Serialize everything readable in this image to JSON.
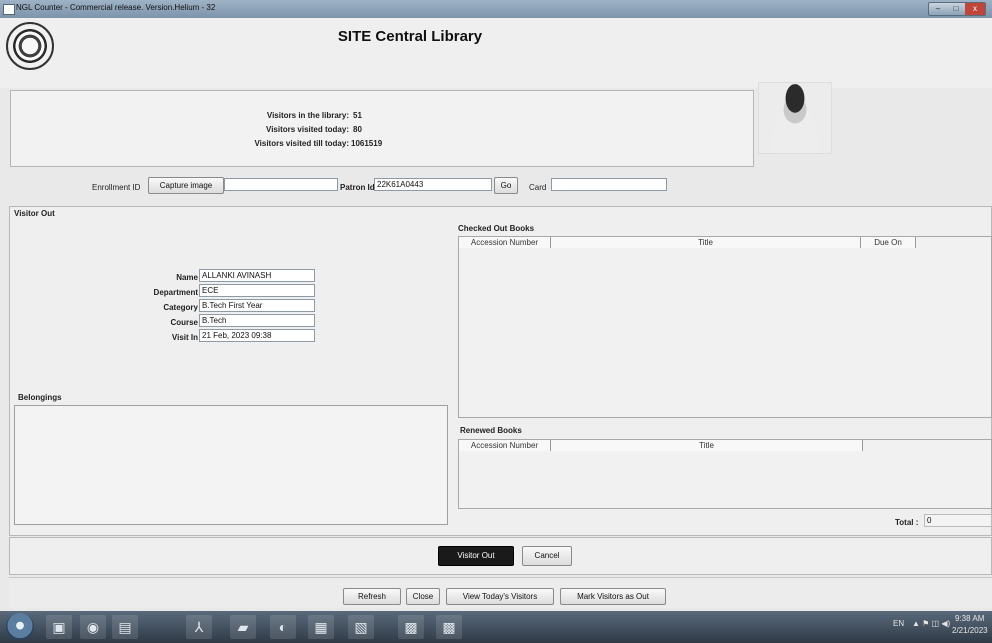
{
  "window": {
    "title": "NGL Counter - Commercial release. Version.Helium - 32",
    "min": "–",
    "max": "□",
    "close": "x"
  },
  "app_title": "SITE Central Library",
  "stats": [
    {
      "label": "Visitors in the library:",
      "value": "51"
    },
    {
      "label": "Visitors visited today:",
      "value": "80"
    },
    {
      "label": "Visitors visited till today:",
      "value": "1061519"
    }
  ],
  "entry": {
    "enrollment_label": "Enrollment ID",
    "capture_button": "Capture image",
    "enrollment_value": "",
    "patron_label": "Patron Id",
    "patron_value": "22K61A0443",
    "go_button": "Go",
    "card_label": "Card",
    "card_value": ""
  },
  "visitor_out": {
    "section_title": "Visitor Out",
    "fields": [
      {
        "label": "Name",
        "value": "ALLANKI AVINASH"
      },
      {
        "label": "Department",
        "value": "ECE"
      },
      {
        "label": "Category",
        "value": "B.Tech First Year"
      },
      {
        "label": "Course",
        "value": "B.Tech"
      },
      {
        "label": "Visit In",
        "value": "21 Feb, 2023 09:38"
      }
    ],
    "belongings_label": "Belongings"
  },
  "checked_out": {
    "title": "Checked Out Books",
    "columns": [
      "Accession Number",
      "Title",
      "Due On"
    ]
  },
  "renewed": {
    "title": "Renewed Books",
    "columns": [
      "Accession Number",
      "Title"
    ]
  },
  "total": {
    "label": "Total :",
    "value": "0"
  },
  "actions": {
    "visitor_out": "Visitor Out",
    "cancel": "Cancel"
  },
  "footer_buttons": {
    "refresh": "Refresh",
    "close": "Close",
    "view_today": "View Today's Visitors",
    "mark_out": "Mark Visitors as Out"
  },
  "taskbar": {
    "tray_text": "EN",
    "time": "9:38 AM",
    "date": "2/21/2023"
  }
}
